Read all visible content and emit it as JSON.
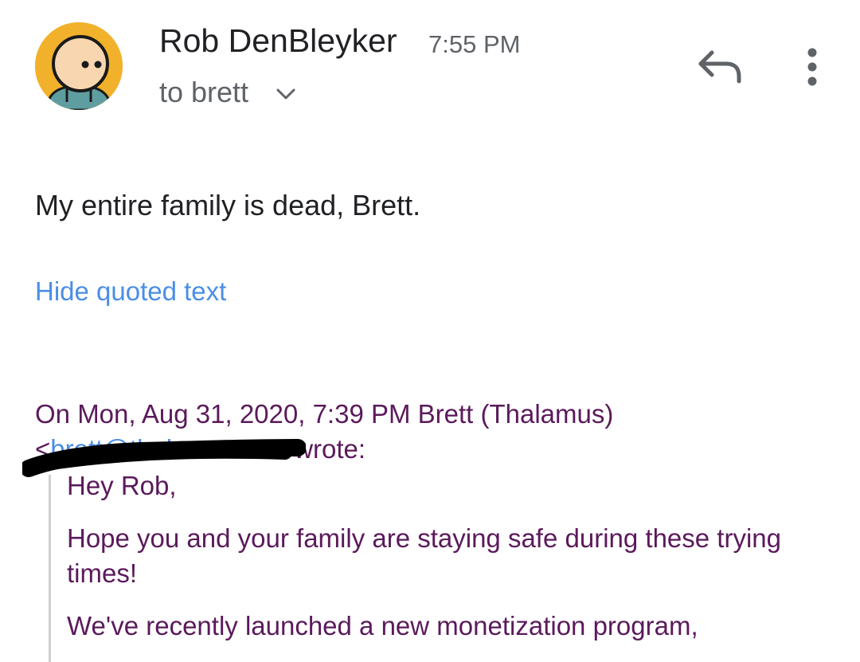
{
  "header": {
    "sender_name": "Rob DenBleyker",
    "time": "7:55 PM",
    "recipient": "to brett"
  },
  "icons": {
    "avatar": "cartoon-avatar",
    "details": "chevron-down-icon",
    "reply": "reply-icon",
    "more": "more-vert-icon"
  },
  "colors": {
    "avatar_bg": "#f2b12b",
    "link": "#4a8ee6",
    "quoted_text": "#5b1a5b"
  },
  "message": {
    "body": "My entire family is dead, Brett."
  },
  "quoted": {
    "toggle_label": "Hide quoted text",
    "attribution_line1": "On Mon, Aug 31, 2020, 7:39 PM Brett (Thalamus)",
    "email_open": "<",
    "email_visible": "brett@thalamus.co",
    "email_close": ">",
    "wrote": " wrote:",
    "greeting": "Hey Rob,",
    "paragraph1": "Hope you and your family are staying safe during these trying times!",
    "paragraph2": "We've recently launched a new monetization program,"
  }
}
